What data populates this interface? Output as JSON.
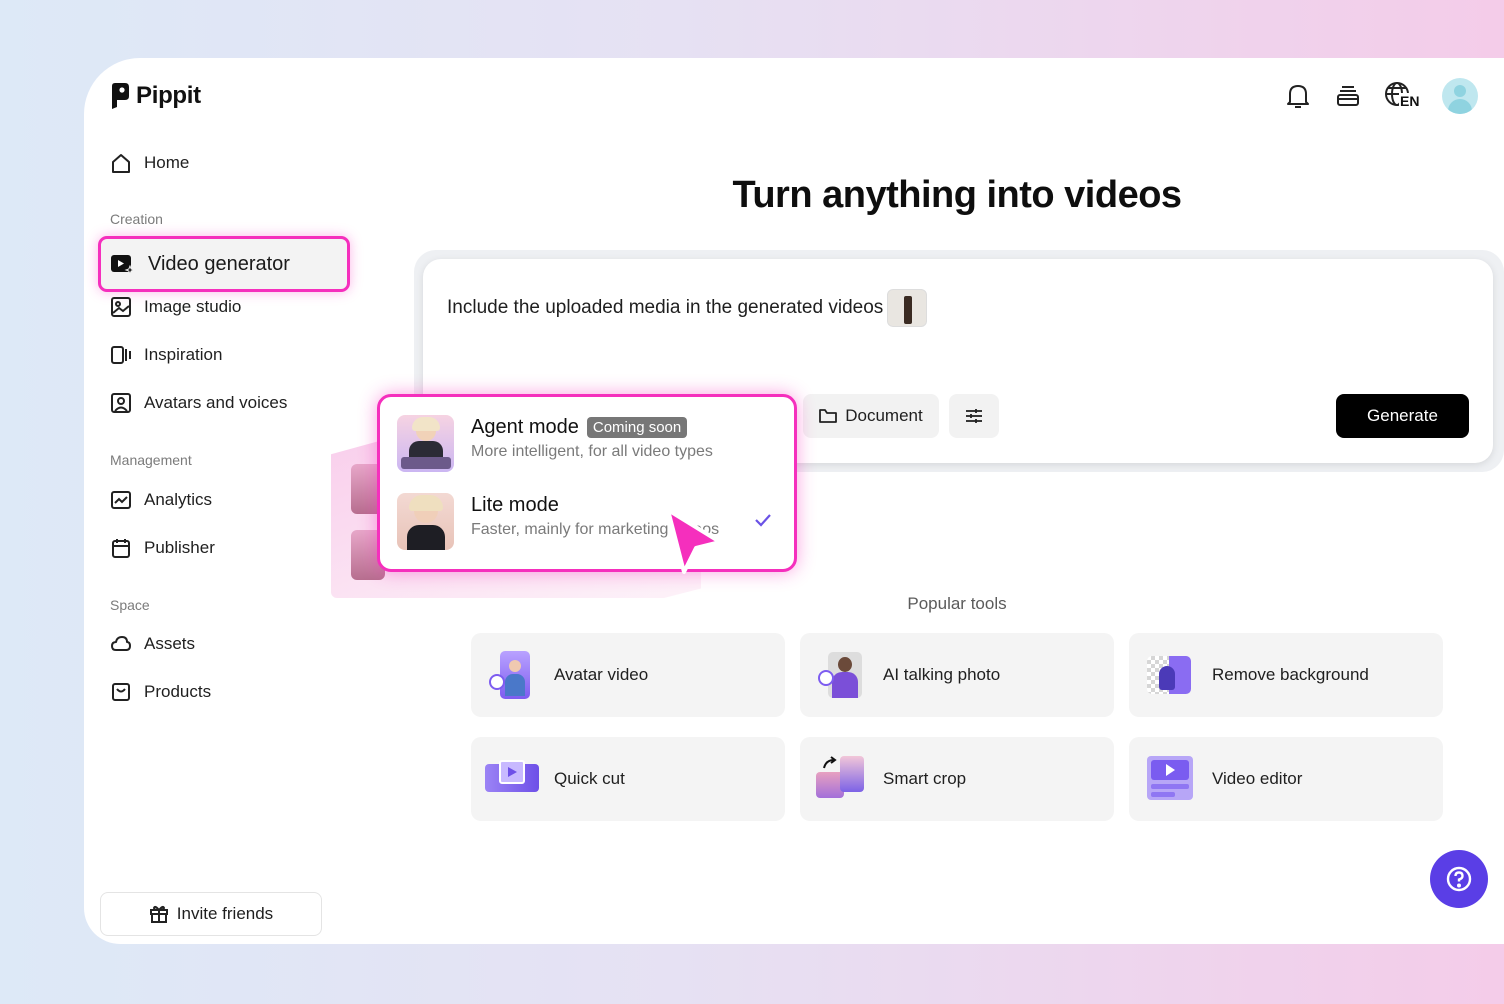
{
  "brand": {
    "name": "Pippit"
  },
  "header": {
    "language": "EN"
  },
  "sidebar": {
    "home": "Home",
    "creation_label": "Creation",
    "creation": [
      "Video generator",
      "Image studio",
      "Inspiration",
      "Avatars and voices"
    ],
    "management_label": "Management",
    "management": [
      "Analytics",
      "Publisher"
    ],
    "space_label": "Space",
    "space": [
      "Assets",
      "Products"
    ],
    "invite": "Invite friends"
  },
  "main": {
    "title": "Turn anything into videos",
    "prompt": "Include the uploaded media in the generated videos",
    "document_button": "Document",
    "generate_button": "Generate",
    "popular_title": "Popular tools",
    "tools": [
      "Avatar video",
      "AI talking photo",
      "Remove background",
      "Quick cut",
      "Smart crop",
      "Video editor"
    ]
  },
  "mode_menu": {
    "agent": {
      "name": "Agent mode",
      "badge": "Coming soon",
      "desc": "More intelligent, for all video types"
    },
    "lite": {
      "name": "Lite mode",
      "desc": "Faster, mainly for marketing videos",
      "selected": true
    }
  },
  "colors": {
    "highlight": "#f52fbd",
    "accent": "#5a3ee6",
    "generate_bg": "#000000"
  }
}
